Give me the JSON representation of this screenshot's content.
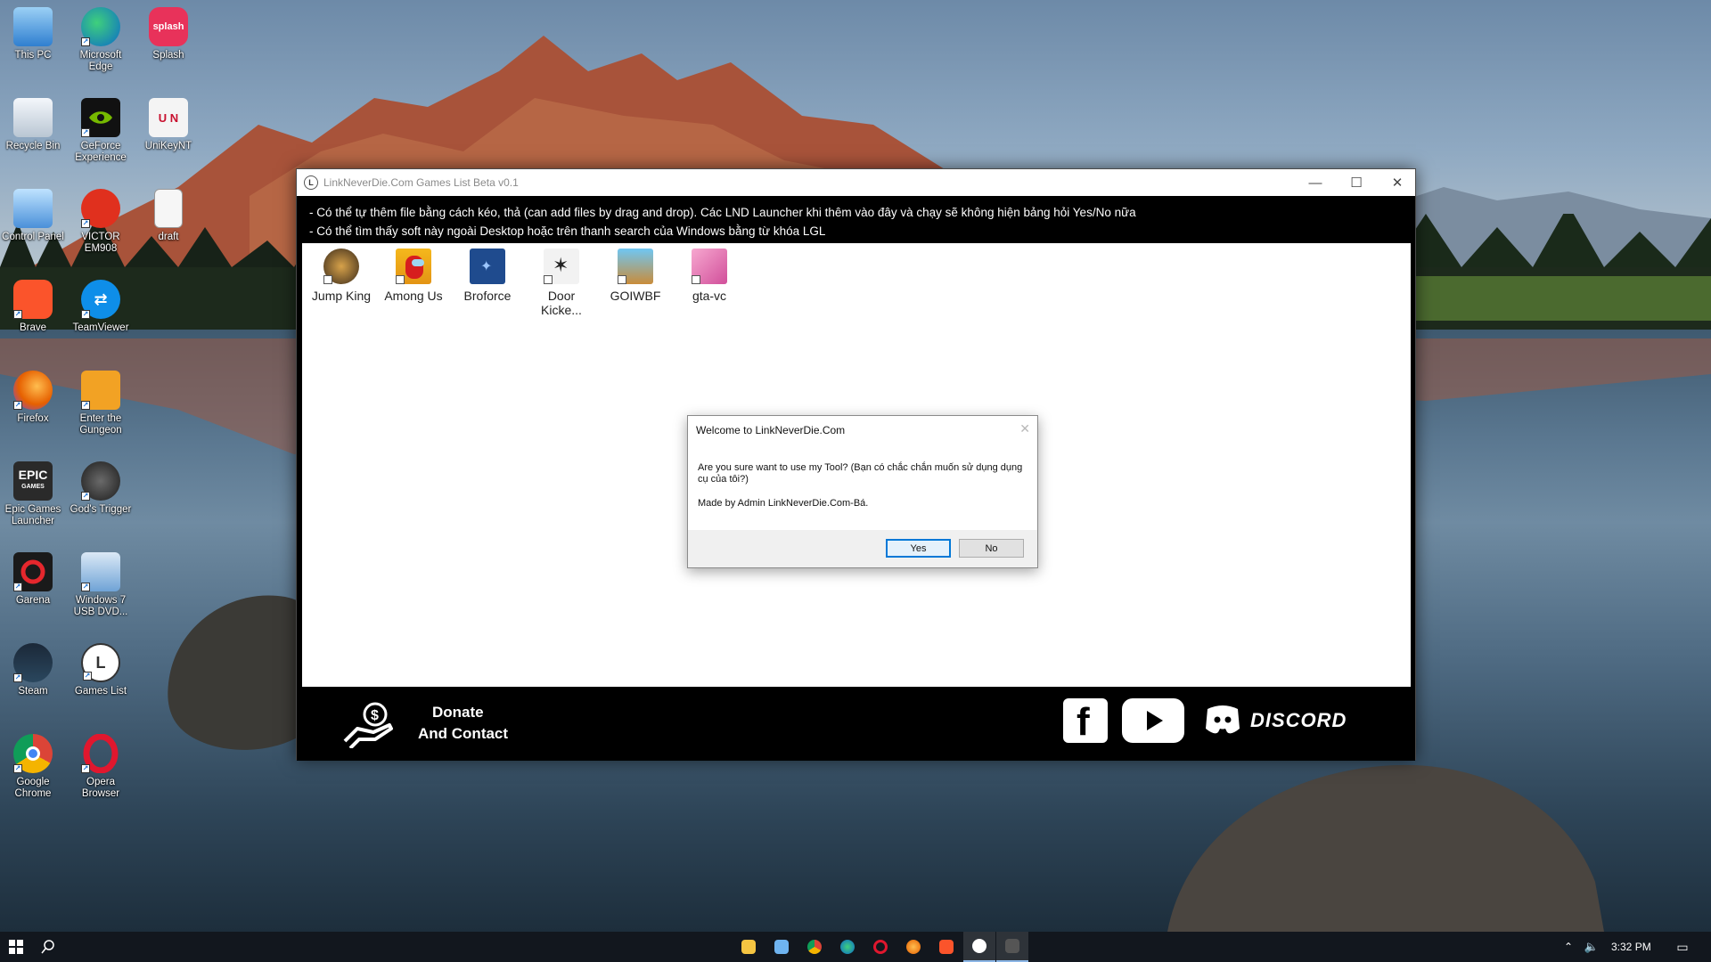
{
  "desktop": {
    "icons": [
      {
        "label": "This PC"
      },
      {
        "label": "Microsoft Edge"
      },
      {
        "label": "Splash"
      },
      {
        "label": "Recycle Bin"
      },
      {
        "label": "GeForce Experience"
      },
      {
        "label": "UniKeyNT"
      },
      {
        "label": "Control Panel"
      },
      {
        "label": "VICTOR EM908"
      },
      {
        "label": "draft"
      },
      {
        "label": "Brave"
      },
      {
        "label": "TeamViewer"
      },
      {
        "label": "Firefox"
      },
      {
        "label": "Enter the Gungeon"
      },
      {
        "label": "Epic Games Launcher"
      },
      {
        "label": "God's Trigger"
      },
      {
        "label": "Garena"
      },
      {
        "label": "Windows 7 USB DVD..."
      },
      {
        "label": "Steam"
      },
      {
        "label": "Games List"
      },
      {
        "label": "Google Chrome"
      },
      {
        "label": "Opera Browser"
      }
    ],
    "glyph_text": {
      "splash": "splash",
      "epic": "EPIC",
      "epic_sub": "GAMES",
      "unikey": "U N"
    }
  },
  "app": {
    "title": "LinkNeverDie.Com Games List Beta v0.1",
    "logo_text": "L",
    "info_lines": [
      "- Có thể tự thêm file bằng cách kéo, thả (can add files by drag and drop). Các LND Launcher khi thêm vào đây và chạy sẽ không hiện bảng hỏi Yes/No nữa",
      "- Có thể tìm thấy soft này ngoài Desktop hoặc trên thanh search của Windows bằng từ khóa LGL"
    ],
    "games": [
      {
        "label": "Jump King"
      },
      {
        "label": "Among Us"
      },
      {
        "label": "Broforce"
      },
      {
        "label": "Door Kicke..."
      },
      {
        "label": "GOIWBF"
      },
      {
        "label": "gta-vc"
      }
    ],
    "footer": {
      "donate_line1": "Donate",
      "donate_line2": "And Contact",
      "discord_label": "DISCORD"
    },
    "window_controls": {
      "minimize": "—",
      "maximize": "☐",
      "close": "✕"
    }
  },
  "dialog": {
    "title": "Welcome to LinkNeverDie.Com",
    "close": "✕",
    "message": "Are you sure want to use my Tool? (Bạn có chắc chắn muốn sử dụng dụng cụ của tôi?)",
    "credit": "Made by Admin LinkNeverDie.Com-Bá.",
    "yes_label": "Yes",
    "no_label": "No"
  },
  "taskbar": {
    "start_icon": "windows-logo-icon",
    "search_icon": "search-icon",
    "time": "3:32 PM"
  },
  "colors": {
    "app_background": "#000000",
    "list_background": "#ffffff",
    "dialog_primary_border": "#0078d7",
    "taskbar": "#12161c"
  }
}
